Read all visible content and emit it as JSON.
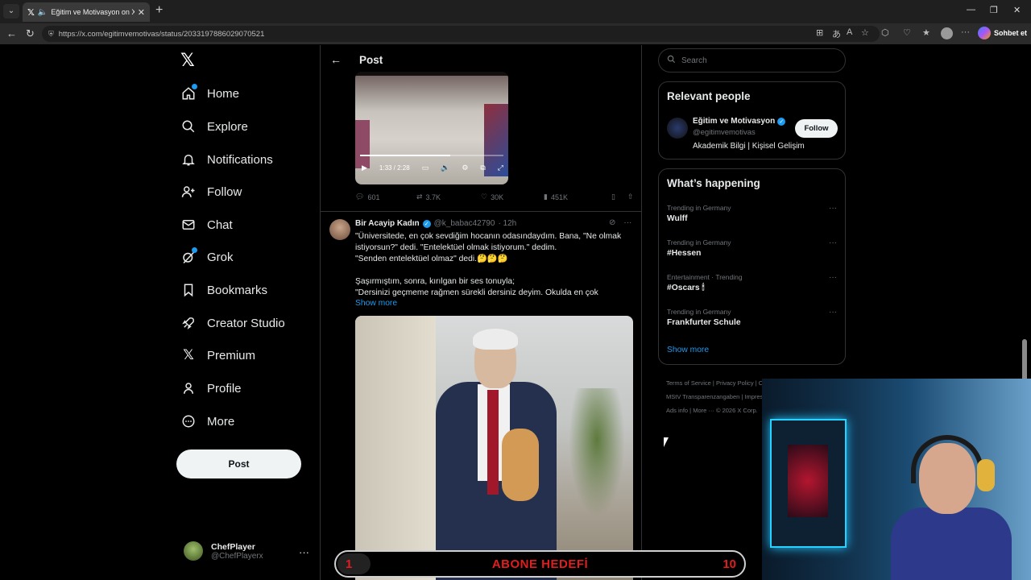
{
  "browser": {
    "tab_title": "Eğitim ve Motivasyon on X: \"Ü",
    "url": "https://x.com/egitimvemotivas/status/2033197886029070521",
    "copilot_label": "Sohbet et"
  },
  "nav": {
    "items": [
      {
        "label": "Home",
        "icon": "home-icon"
      },
      {
        "label": "Explore",
        "icon": "search-icon"
      },
      {
        "label": "Notifications",
        "icon": "bell-icon"
      },
      {
        "label": "Follow",
        "icon": "person-add-icon"
      },
      {
        "label": "Chat",
        "icon": "mail-icon"
      },
      {
        "label": "Grok",
        "icon": "grok-icon"
      },
      {
        "label": "Bookmarks",
        "icon": "bookmark-icon"
      },
      {
        "label": "Creator Studio",
        "icon": "rocket-icon"
      },
      {
        "label": "Premium",
        "icon": "x-icon"
      },
      {
        "label": "Profile",
        "icon": "person-icon"
      },
      {
        "label": "More",
        "icon": "more-circle-icon"
      }
    ],
    "post_button": "Post",
    "account": {
      "name": "ChefPlayer",
      "handle": "@ChefPlayerx"
    }
  },
  "main": {
    "header_title": "Post",
    "video": {
      "time": "1:33 / 2:28",
      "progress": 0.63
    },
    "stats": {
      "replies": "601",
      "reposts": "3.7K",
      "likes": "30K",
      "views": "451K"
    },
    "reply": {
      "name": "Bir Acayip Kadın",
      "handle": "@k_babac42790",
      "time": "· 12h",
      "text": "\"Üniversitede, en çok sevdiğim hocanın odasındaydım. Bana, \"Ne olmak istiyorsun?\" dedi. \"Entelektüel olmak istiyorum.\" dedim.\n\"Senden entelektüel olmaz\" dedi.🤔🤔🤔\n\nŞaşırmıştım, sonra, kırılgan bir ses tonuyla;\n\"Dersinizi geçmeme rağmen sürekli dersiniz deyim. Okulda en çok",
      "show_more": "Show more"
    }
  },
  "right": {
    "search_placeholder": "Search",
    "relevant_title": "Relevant people",
    "person": {
      "name": "Eğitim ve Motivasyon",
      "handle": "@egitimvemotivas",
      "bio": "Akademik Bilgi | Kişisel Gelişim",
      "follow": "Follow"
    },
    "happening_title": "What’s happening",
    "trends": [
      {
        "meta": "Trending in Germany",
        "name": "Wulff"
      },
      {
        "meta": "Trending in Germany",
        "name": "#Hessen"
      },
      {
        "meta": "Entertainment · Trending",
        "name": "#Oscars 🕯"
      },
      {
        "meta": "Trending in Germany",
        "name": "Frankfurter Schule"
      }
    ],
    "trends_show_more": "Show more",
    "footer": {
      "line1": "Terms of Service  |  Privacy Policy  |  Cookie Policy",
      "line2": "MStV Transparenzangaben  |  Impressum",
      "line3": "Ads info  |  More ···  © 2026 X Corp."
    }
  },
  "goal": {
    "start": "1",
    "label": "ABONE HEDEFİ",
    "end": "10",
    "progress": 0.08,
    "color": "#e21d1d"
  }
}
